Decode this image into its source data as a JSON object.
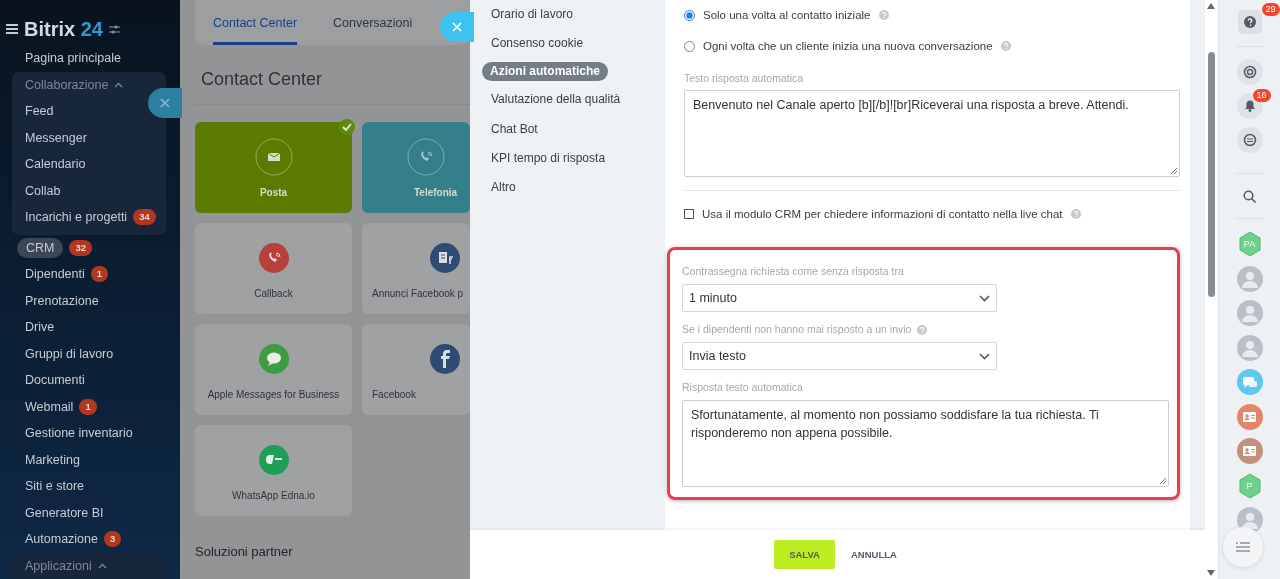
{
  "sidebar": {
    "logo": {
      "name": "Bitrix",
      "number": "24"
    },
    "items": [
      {
        "kind": "link",
        "label": "Pagina principale",
        "selected": false
      },
      {
        "kind": "group",
        "label": "Collaborazione",
        "expanded": true,
        "children": [
          {
            "kind": "link",
            "label": "Feed",
            "selected": false
          },
          {
            "kind": "link",
            "label": "Messenger",
            "selected": false
          },
          {
            "kind": "link",
            "label": "Calendario",
            "selected": false
          },
          {
            "kind": "link",
            "label": "Collab",
            "selected": false
          },
          {
            "kind": "link",
            "label": "Incarichi e progetti",
            "badge": "34",
            "selected": false
          }
        ]
      },
      {
        "kind": "link",
        "label": "CRM",
        "badge": "32",
        "selected": true
      },
      {
        "kind": "link",
        "label": "Dipendenti",
        "badge": "1",
        "selected": false
      },
      {
        "kind": "link",
        "label": "Prenotazione",
        "selected": false
      },
      {
        "kind": "link",
        "label": "Drive",
        "selected": false
      },
      {
        "kind": "link",
        "label": "Gruppi di lavoro",
        "selected": false
      },
      {
        "kind": "link",
        "label": "Documenti",
        "selected": false
      },
      {
        "kind": "link",
        "label": "Webmail",
        "badge": "1",
        "selected": false
      },
      {
        "kind": "link",
        "label": "Gestione inventario",
        "selected": false
      },
      {
        "kind": "link",
        "label": "Marketing",
        "selected": false
      },
      {
        "kind": "link",
        "label": "Siti e store",
        "selected": false
      },
      {
        "kind": "link",
        "label": "Generatore BI",
        "selected": false
      },
      {
        "kind": "link",
        "label": "Automazione",
        "badge": "3",
        "selected": false
      },
      {
        "kind": "group",
        "label": "Applicazioni",
        "expanded": true
      }
    ]
  },
  "page": {
    "tabs": [
      {
        "label": "Contact Center",
        "selected": true
      },
      {
        "label": "Conversazioni",
        "selected": false
      }
    ],
    "title": "Contact Center",
    "tiles": [
      {
        "label": "Posta",
        "active": true,
        "connected": true,
        "color": "#5a7a00"
      },
      {
        "label": "Telefonia",
        "active": true,
        "connected": false,
        "color": "#357f8a"
      },
      {
        "label": "Callback",
        "active": false,
        "connected": false,
        "color": "#b8403a"
      },
      {
        "label": "Annunci Facebook p",
        "active": false,
        "connected": false,
        "color": "#2f4a73"
      },
      {
        "label": "Apple Messages for Business",
        "active": false,
        "connected": false,
        "color": "#3f9a44"
      },
      {
        "label": "Facebook",
        "active": false,
        "connected": false,
        "color": "#2f4a73"
      },
      {
        "label": "WhatsApp Edna.io",
        "active": false,
        "connected": false,
        "color": "#1f9e56"
      }
    ],
    "section_title": "Soluzioni partner"
  },
  "panel": {
    "nav": [
      {
        "label": "Orario di lavoro",
        "selected": false
      },
      {
        "label": "Consenso cookie",
        "selected": false
      },
      {
        "label": "Azioni automatiche",
        "selected": true
      },
      {
        "label": "Valutazione della qualità",
        "selected": false
      },
      {
        "label": "Chat Bot",
        "selected": false
      },
      {
        "label": "KPI tempo di risposta",
        "selected": false
      },
      {
        "label": "Altro",
        "selected": false
      }
    ],
    "radios": [
      {
        "label": "Solo una volta al contatto iniziale",
        "selected": true
      },
      {
        "label": "Ogni volta che un cliente inizia una nuova conversazione",
        "selected": false
      }
    ],
    "auto_reply": {
      "label": "Testo risposta automatica",
      "value": "Benvenuto nel Canale aperto [b][/b]![br]Riceverai una risposta a breve. Attendi."
    },
    "crm_form": {
      "label": "Usa il modulo CRM per chiedere informazioni di contatto nella live chat",
      "checked": false
    },
    "highlighted": [
      {
        "kind": "select",
        "label": "Contrassegna richiesta come senza risposta tra",
        "value": "1 minuto",
        "help": false
      },
      {
        "kind": "select",
        "label": "Se i dipendenti non hanno mai risposto a un invio",
        "value": "Invia testo",
        "help": true
      },
      {
        "kind": "textarea",
        "label": "Risposta testo automatica",
        "value": "Sfortunatamente, al momento non possiamo soddisfare la tua richiesta. Ti risponderemo non appena possibile."
      }
    ],
    "buttons": [
      {
        "label": "SALVA",
        "kind": "primary"
      },
      {
        "label": "ANNULLA",
        "kind": "link"
      }
    ]
  },
  "right_bar": {
    "help_badge": "29",
    "notifications_badge": "16",
    "contacts": [
      {
        "kind": "initials",
        "text": "PA"
      },
      {
        "kind": "avatar"
      },
      {
        "kind": "avatar"
      },
      {
        "kind": "avatar"
      },
      {
        "kind": "chat",
        "color": "#5ec8ef"
      },
      {
        "kind": "card",
        "color": "#e0866b"
      },
      {
        "kind": "card",
        "color": "#c4917c"
      },
      {
        "kind": "initials",
        "text": "P"
      },
      {
        "kind": "avatar"
      }
    ]
  }
}
